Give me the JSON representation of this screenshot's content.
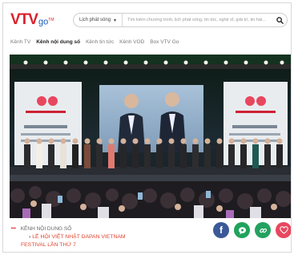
{
  "header": {
    "logo_main": "VTV",
    "logo_sub": "go",
    "schedule_label": "Lịch phát sóng",
    "search_placeholder": "Tìm kiếm chương trình, lịch phát sóng, tin tức, nghệ sĩ, giải trí, tin hài..."
  },
  "nav": {
    "items": [
      "Kênh TV",
      "Kênh nội dung số",
      "Kênh tin tức",
      "Kênh VOD",
      "Box VTV Go"
    ],
    "active_index": 1
  },
  "article": {
    "category": "KÊNH NỘI DUNG SỐ",
    "title_line1": "LỄ HỘI VIỆT NHẬT DAPAN VIETNAM",
    "title_line2": "FESTIVAL LẦN THỨ 7"
  },
  "share": {
    "facebook_color": "#3b5998",
    "zalo_color": "#1fa35c",
    "link_color": "#24a160",
    "heart_color": "#e8475f"
  },
  "icons": [
    "search-icon",
    "chevron-down-icon",
    "channel-icon",
    "facebook-icon",
    "zalo-icon",
    "link-icon",
    "heart-icon"
  ]
}
